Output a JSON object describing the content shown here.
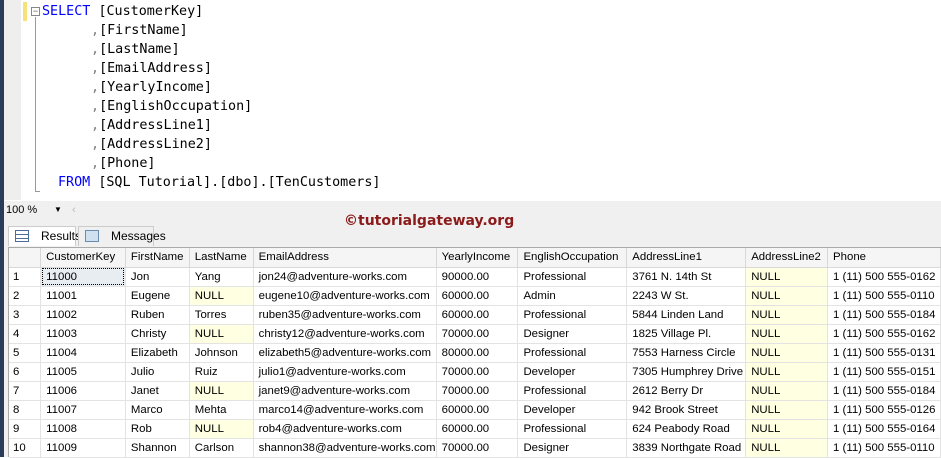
{
  "editor": {
    "select_kw": "SELECT",
    "from_kw": "FROM",
    "columns": [
      "[CustomerKey]",
      "[FirstName]",
      "[LastName]",
      "[EmailAddress]",
      "[YearlyIncome]",
      "[EnglishOccupation]",
      "[AddressLine1]",
      "[AddressLine2]",
      "[Phone]"
    ],
    "from_target": "[SQL Tutorial].[dbo].[TenCustomers]"
  },
  "zoom": {
    "value": "100 %"
  },
  "watermark": "©tutorialgateway.org",
  "tabs": {
    "results": "Results",
    "messages": "Messages"
  },
  "grid": {
    "headers": [
      "CustomerKey",
      "FirstName",
      "LastName",
      "EmailAddress",
      "YearlyIncome",
      "EnglishOccupation",
      "AddressLine1",
      "AddressLine2",
      "Phone"
    ],
    "rows": [
      [
        "1",
        "11000",
        "Jon",
        "Yang",
        "jon24@adventure-works.com",
        "90000.00",
        "Professional",
        "3761 N. 14th St",
        "NULL",
        "1 (11) 500 555-0162"
      ],
      [
        "2",
        "11001",
        "Eugene",
        "NULL",
        "eugene10@adventure-works.com",
        "60000.00",
        "Admin",
        "2243 W St.",
        "NULL",
        "1 (11) 500 555-0110"
      ],
      [
        "3",
        "11002",
        "Ruben",
        "Torres",
        "ruben35@adventure-works.com",
        "60000.00",
        "Professional",
        "5844 Linden Land",
        "NULL",
        "1 (11) 500 555-0184"
      ],
      [
        "4",
        "11003",
        "Christy",
        "NULL",
        "christy12@adventure-works.com",
        "70000.00",
        "Designer",
        "1825 Village Pl.",
        "NULL",
        "1 (11) 500 555-0162"
      ],
      [
        "5",
        "11004",
        "Elizabeth",
        "Johnson",
        "elizabeth5@adventure-works.com",
        "80000.00",
        "Professional",
        "7553 Harness Circle",
        "NULL",
        "1 (11) 500 555-0131"
      ],
      [
        "6",
        "11005",
        "Julio",
        "Ruiz",
        "julio1@adventure-works.com",
        "70000.00",
        "Developer",
        "7305 Humphrey Drive",
        "NULL",
        "1 (11) 500 555-0151"
      ],
      [
        "7",
        "11006",
        "Janet",
        "NULL",
        "janet9@adventure-works.com",
        "70000.00",
        "Professional",
        "2612 Berry Dr",
        "NULL",
        "1 (11) 500 555-0184"
      ],
      [
        "8",
        "11007",
        "Marco",
        "Mehta",
        "marco14@adventure-works.com",
        "60000.00",
        "Developer",
        "942 Brook Street",
        "NULL",
        "1 (11) 500 555-0126"
      ],
      [
        "9",
        "11008",
        "Rob",
        "NULL",
        "rob4@adventure-works.com",
        "60000.00",
        "Professional",
        "624 Peabody Road",
        "NULL",
        "1 (11) 500 555-0164"
      ],
      [
        "10",
        "11009",
        "Shannon",
        "Carlson",
        "shannon38@adventure-works.com",
        "70000.00",
        "Designer",
        "3839 Northgate Road",
        "NULL",
        "1 (11) 500 555-0110"
      ]
    ]
  }
}
